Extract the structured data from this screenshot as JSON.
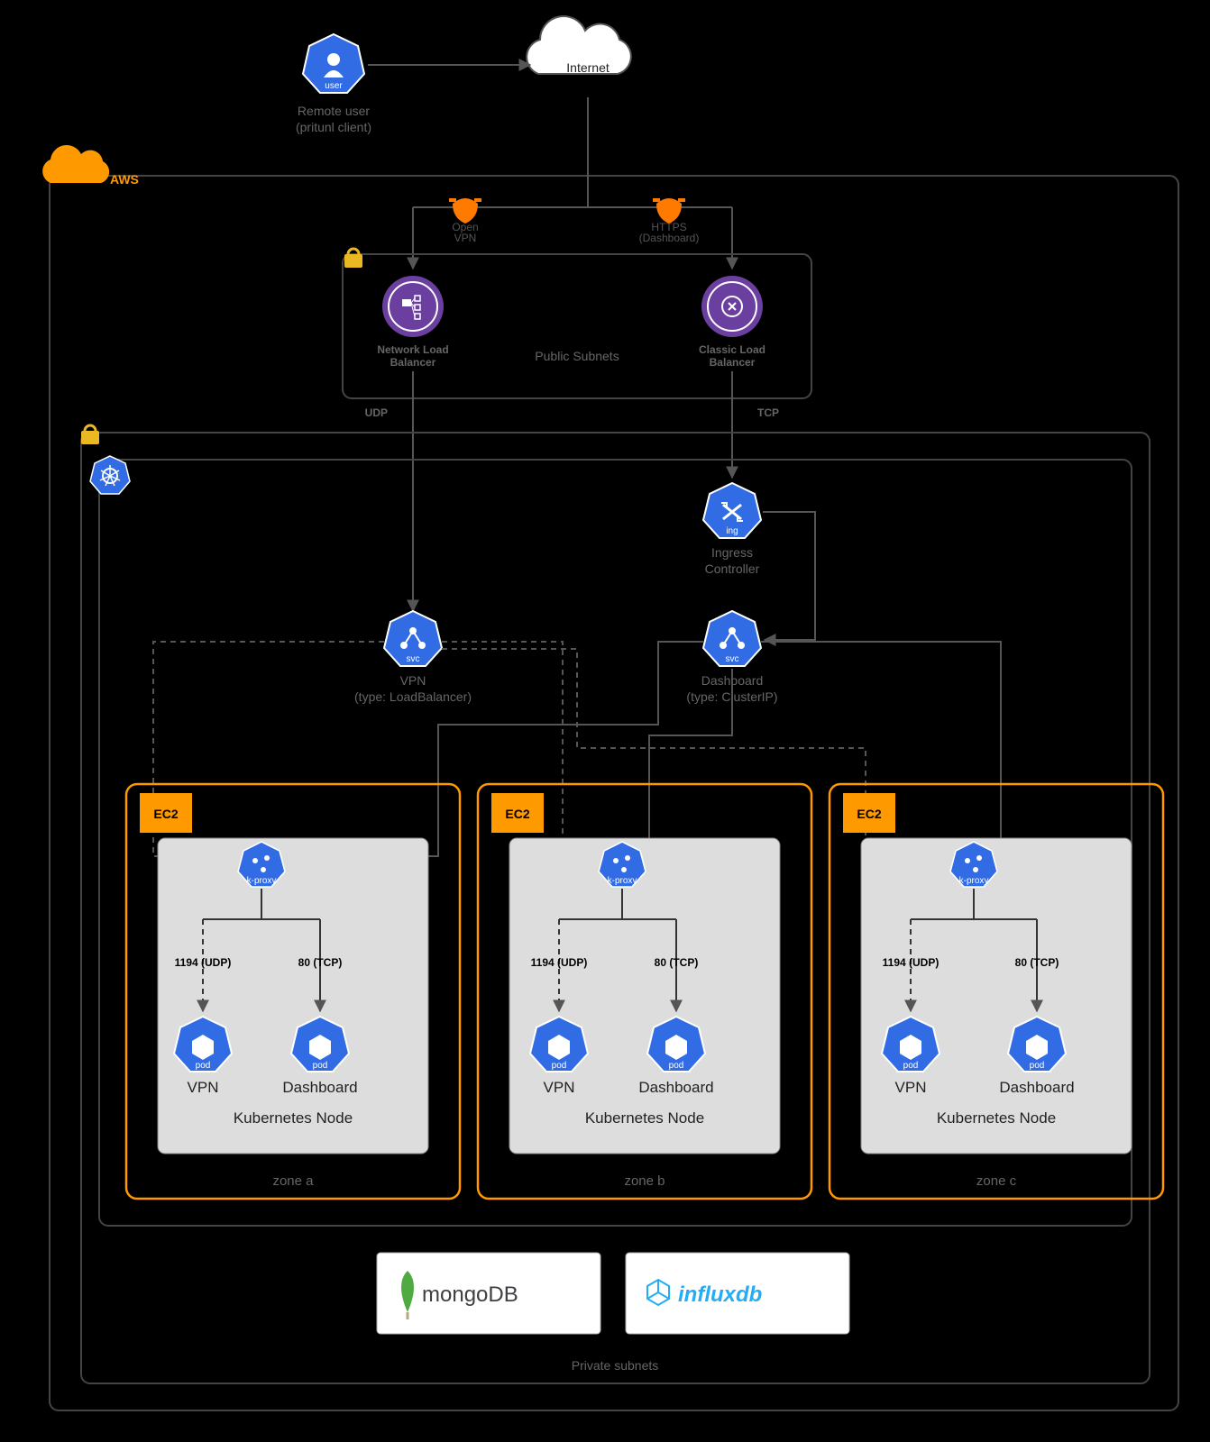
{
  "top": {
    "user_icon_sub": "user",
    "remote_user_l1": "Remote user",
    "remote_user_l2": "(pritunl client)",
    "internet": "Internet"
  },
  "aws_label": "AWS",
  "protocols": {
    "openvpn_l1": "Open",
    "openvpn_l2": "VPN",
    "https_l1": "HTTPS",
    "https_l2": "(Dashboard)"
  },
  "public_subnets": {
    "title": "Public Subnets",
    "nlb_l1": "Network Load",
    "nlb_l2": "Balancer",
    "clb_l1": "Classic Load",
    "clb_l2": "Balancer"
  },
  "transport": {
    "udp": "UDP",
    "tcp": "TCP"
  },
  "ingress": {
    "sub": "ing",
    "l1": "Ingress",
    "l2": "Controller"
  },
  "svc": {
    "sub": "svc",
    "vpn_l1": "VPN",
    "vpn_l2": "(type: LoadBalancer)",
    "dash_l1": "Dashboard",
    "dash_l2": "(type: ClusterIP)"
  },
  "zones": {
    "ec2": "EC2",
    "kproxy_sub": "k-proxy",
    "port_vpn": "1194 (UDP)",
    "port_dash": "80 (TCP)",
    "pod_sub": "pod",
    "pod_vpn": "VPN",
    "pod_dash": "Dashboard",
    "node": "Kubernetes Node",
    "a": "zone a",
    "b": "zone b",
    "c": "zone c"
  },
  "private_subnets": "Private subnets",
  "db": {
    "mongo": "mongoDB",
    "influx": "influxdb"
  },
  "colors": {
    "bg": "#000000",
    "orange": "#ff9900",
    "k8s_blue": "#326ce5",
    "purple": "#6b3fa0",
    "grey_line": "#444444",
    "grey_fill": "#dddddd",
    "lock": "#e8b923",
    "influx": "#22adf6",
    "mongo_leaf": "#4faa41",
    "mongo_text": "#3f3e42"
  }
}
